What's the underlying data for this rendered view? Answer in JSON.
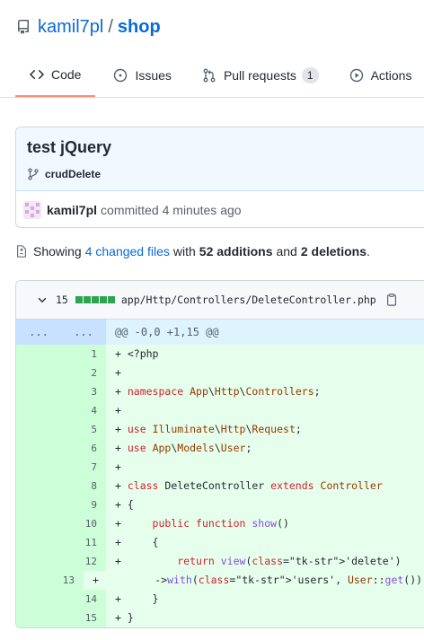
{
  "repo": {
    "owner": "kamil7pl",
    "separator": "/",
    "name": "shop"
  },
  "tabs": [
    {
      "label": "Code",
      "icon": "code-icon",
      "active": true
    },
    {
      "label": "Issues",
      "icon": "issue-icon"
    },
    {
      "label": "Pull requests",
      "icon": "pull-request-icon",
      "count": "1"
    },
    {
      "label": "Actions",
      "icon": "play-icon"
    }
  ],
  "commit": {
    "title": "test jQuery",
    "branch": "crudDelete",
    "author": "kamil7pl",
    "action": "committed",
    "time": "4 minutes ago"
  },
  "summary": {
    "prefix": "Showing",
    "changed_files": "4 changed files",
    "with": "with",
    "additions": "52 additions",
    "and": "and",
    "deletions": "2 deletions",
    "suffix": "."
  },
  "file": {
    "changes": "15",
    "path": "app/Http/Controllers/DeleteController.php",
    "hunk_left": "...",
    "hunk_right": "...",
    "hunk_header": "@@ -0,0 +1,15 @@",
    "lines": [
      {
        "num": "1",
        "code": "+ <?php"
      },
      {
        "num": "2",
        "code": "+"
      },
      {
        "num": "3",
        "code": "+ namespace App\\Http\\Controllers;"
      },
      {
        "num": "4",
        "code": "+"
      },
      {
        "num": "5",
        "code": "+ use Illuminate\\Http\\Request;"
      },
      {
        "num": "6",
        "code": "+ use App\\Models\\User;"
      },
      {
        "num": "7",
        "code": "+"
      },
      {
        "num": "8",
        "code": "+ class DeleteController extends Controller"
      },
      {
        "num": "9",
        "code": "+ {"
      },
      {
        "num": "10",
        "code": "+     public function show()"
      },
      {
        "num": "11",
        "code": "+     {"
      },
      {
        "num": "12",
        "code": "+         return view('delete')"
      },
      {
        "num": "13",
        "code": "+         ->with('users', User::get());"
      },
      {
        "num": "14",
        "code": "+     }"
      },
      {
        "num": "15",
        "code": "+ }"
      }
    ]
  },
  "colors": {
    "link": "#0969da",
    "addition_bg": "#e6ffec",
    "addition_gutter": "#ccffd8",
    "hunk_bg": "#ddf4ff",
    "active_tab_underline": "#fd8c73"
  }
}
